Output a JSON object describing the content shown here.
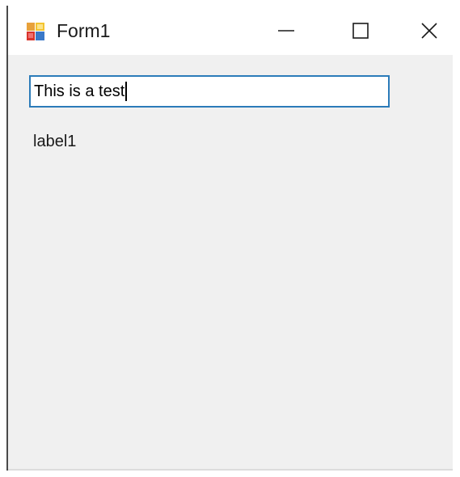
{
  "window": {
    "title": "Form1",
    "controls": {
      "minimize_icon": "minimize-icon",
      "maximize_icon": "maximize-icon",
      "close_icon": "close-icon"
    }
  },
  "form": {
    "textbox": {
      "value": "This is a test"
    },
    "label1": {
      "text": "label1"
    }
  },
  "colors": {
    "titlebar_bg": "#ffffff",
    "client_bg": "#f0f0f0",
    "textbox_focus_border": "#2b7bb9"
  }
}
